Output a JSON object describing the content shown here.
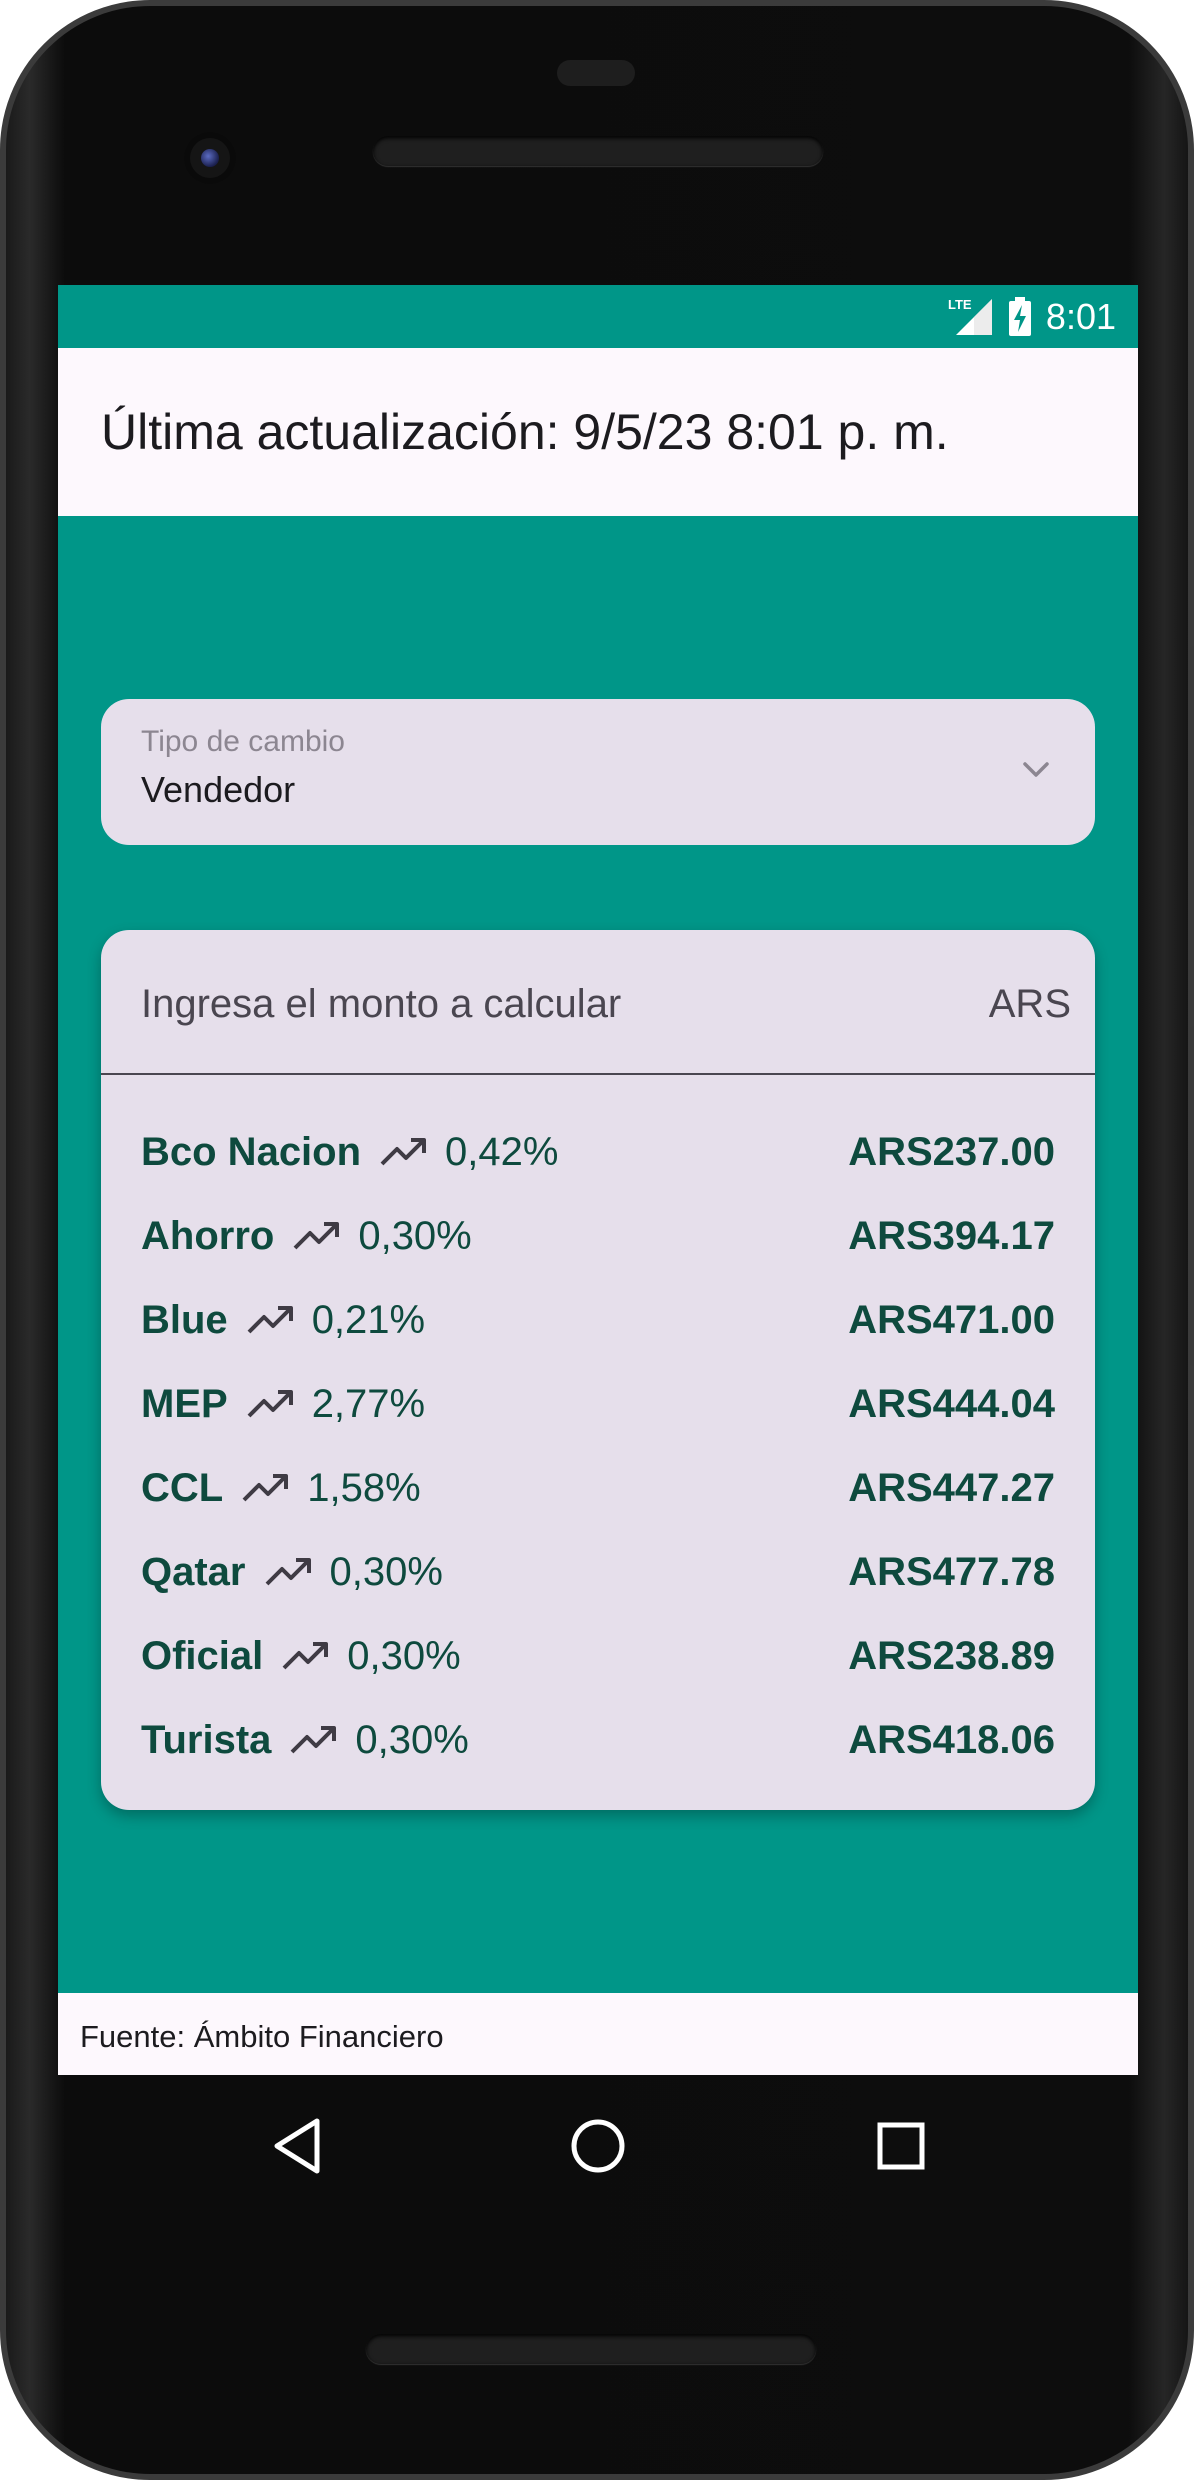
{
  "status_bar": {
    "network": "LTE",
    "time": "8:01"
  },
  "header": {
    "title": "Última actualización: 9/5/23 8:01 p. m."
  },
  "exchange_type": {
    "label": "Tipo de cambio",
    "value": "Vendedor"
  },
  "calculator": {
    "placeholder": "Ingresa el monto a calcular",
    "suffix": "ARS"
  },
  "rates": [
    {
      "name": "Bco Nacion",
      "pct": "0,42%",
      "value": "ARS237.00"
    },
    {
      "name": "Ahorro",
      "pct": "0,30%",
      "value": "ARS394.17"
    },
    {
      "name": "Blue",
      "pct": "0,21%",
      "value": "ARS471.00"
    },
    {
      "name": "MEP",
      "pct": "2,77%",
      "value": "ARS444.04"
    },
    {
      "name": "CCL",
      "pct": "1,58%",
      "value": "ARS447.27"
    },
    {
      "name": "Qatar",
      "pct": "0,30%",
      "value": "ARS477.78"
    },
    {
      "name": "Oficial",
      "pct": "0,30%",
      "value": "ARS238.89"
    },
    {
      "name": "Turista",
      "pct": "0,30%",
      "value": "ARS418.06"
    }
  ],
  "footer": {
    "source": "Fuente: Ámbito Financiero"
  },
  "colors": {
    "primary": "#009688",
    "surface": "#e6dfeb",
    "text_accent": "#0e4a3e"
  },
  "icons": {
    "trend": "trending-up-icon",
    "dropdown": "chevron-down-icon",
    "nav": [
      "back-icon",
      "home-icon",
      "recents-icon"
    ]
  }
}
